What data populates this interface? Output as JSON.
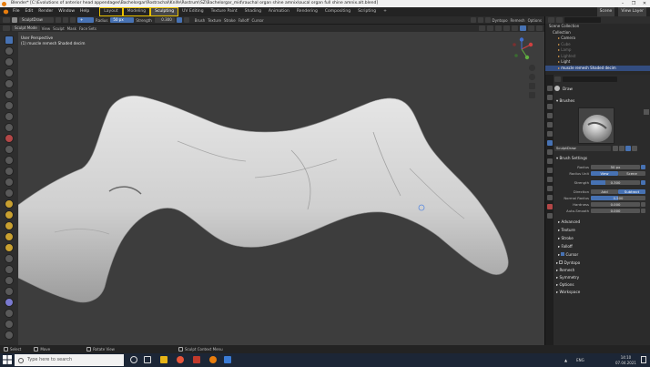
{
  "window": {
    "title": "Blender* [C:\\Evolutions of anterior head appendages\\Bachelorgar\\Rostrachal\\Knife\\Rostrum\\SZ\\Bachelorgar_mid\\rauchal organ shine amnix\\oucal organ full shine amnix.alt.blend]",
    "controls": [
      "–",
      "❐",
      "✕"
    ]
  },
  "menu": {
    "items": [
      "File",
      "Edit",
      "Render",
      "Window",
      "Help"
    ],
    "workspaces": [
      "Layout",
      "Modeling",
      "Sculpting",
      "UV Editing",
      "Texture Paint",
      "Shading",
      "Animation",
      "Rendering",
      "Compositing",
      "Scripting",
      "+"
    ],
    "active_workspace": "Sculpting",
    "scene_label": "Scene",
    "view_layer_label": "View Layer"
  },
  "toolheader": {
    "brush_name": "SculptDraw",
    "radius_label": "Radius",
    "radius_value": "50 px",
    "strength_label": "Strength",
    "strength_value": "0.300",
    "direction_label": "+",
    "dropdowns": [
      "Brush",
      "Texture",
      "Stroke",
      "Falloff",
      "Cursor"
    ],
    "right_items": [
      "Dyntopo",
      "Remesh",
      "Options"
    ]
  },
  "viewport_header": {
    "mode": "Sculpt Mode",
    "menus": [
      "View",
      "Sculpt",
      "Mask",
      "Face Sets"
    ]
  },
  "viewport": {
    "perspective": "User Perspective",
    "object_info": "(1) muscle remesh Shaded decim"
  },
  "outliner": {
    "title": "Scene Collection",
    "rows": [
      {
        "label": "Scene Collection",
        "indent": 0,
        "selected": false
      },
      {
        "label": "Collection",
        "indent": 1,
        "selected": false
      },
      {
        "label": "Camera",
        "indent": 2,
        "selected": false
      },
      {
        "label": "Cube",
        "indent": 2,
        "selected": false
      },
      {
        "label": "Lamp",
        "indent": 2,
        "selected": false
      },
      {
        "label": "Lightest",
        "indent": 2,
        "selected": false
      },
      {
        "label": "Light",
        "indent": 2,
        "selected": false
      },
      {
        "label": "muscle remesh Shaded decim",
        "indent": 2,
        "selected": true
      }
    ]
  },
  "properties": {
    "brush_header": "Draw",
    "brushes_label": "Brushes",
    "brush_name": "SculptDraw",
    "brush_settings_label": "Brush Settings",
    "radius_label": "Radius",
    "radius_value": "50 px",
    "radius_unit_label": "Radius Unit",
    "radius_unit_options": [
      "View",
      "Scene"
    ],
    "strength_label": "Strength",
    "strength_value": "0.300",
    "direction_label": "Direction",
    "direction_options": [
      "Add",
      "Subtract"
    ],
    "normal_radius_label": "Normal Radius",
    "normal_radius_value": "0.500",
    "hardness_label": "Hardness",
    "hardness_value": "0.000",
    "autosmooth_label": "Auto-Smooth",
    "autosmooth_value": "0.000",
    "subsections": [
      "Advanced",
      "Texture",
      "Stroke",
      "Falloff",
      "Cursor"
    ],
    "panels": [
      "Dyntopo",
      "Remesh",
      "Symmetry",
      "Options",
      "Workspace"
    ]
  },
  "statusbar": {
    "left": [
      "Select",
      "Move"
    ],
    "middle": "Rotate View",
    "right_hint": "Sculpt Context Menu"
  },
  "taskbar": {
    "search_placeholder": "Type here to search",
    "language": "ENG",
    "time": "14:10",
    "date": "07.04.2021"
  },
  "colors": {
    "accent_blue": "#4772b3",
    "workspace_highlight": "#e8c000",
    "viewport_bg": "#3d3d3d",
    "mesh": "#d6d6d6"
  }
}
